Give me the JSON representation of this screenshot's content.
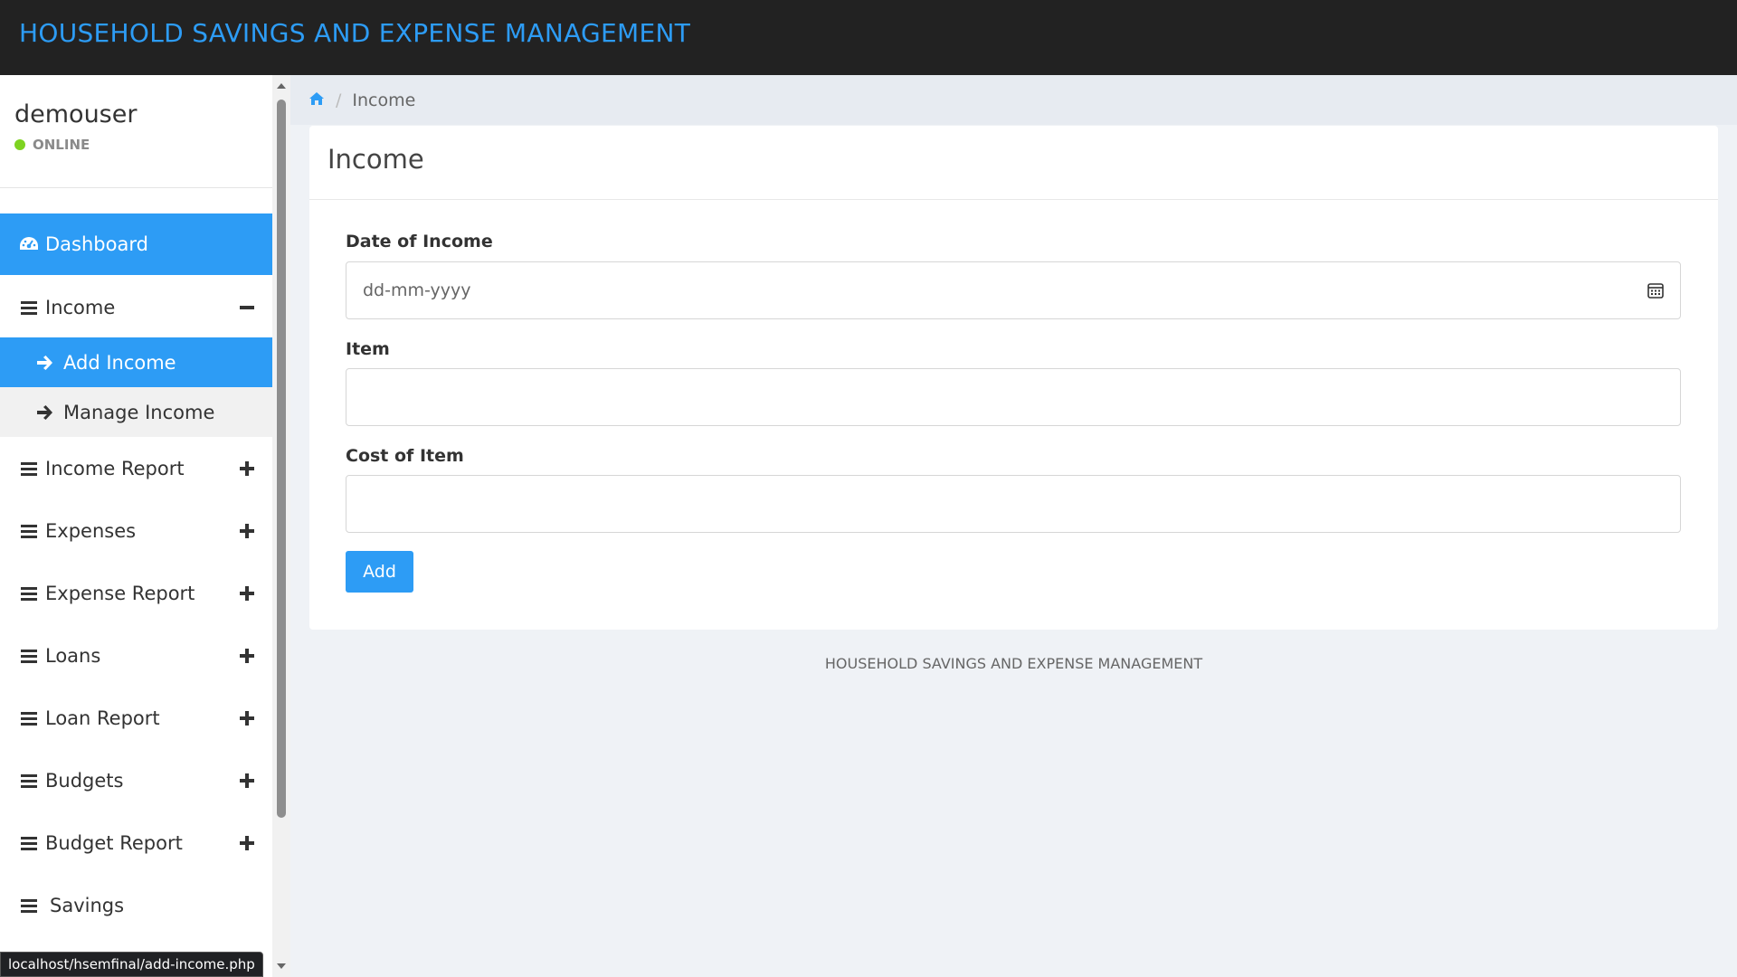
{
  "app": {
    "title": "HOUSEHOLD SAVINGS AND EXPENSE MANAGEMENT"
  },
  "user": {
    "name": "demouser",
    "status": "ONLINE"
  },
  "sidebar": {
    "dashboard": "Dashboard",
    "income": "Income",
    "add_income": "Add Income",
    "manage_income": "Manage Income",
    "income_report": "Income Report",
    "expenses": "Expenses",
    "expense_report": "Expense Report",
    "loans": "Loans",
    "loan_report": "Loan Report",
    "budgets": "Budgets",
    "budget_report": "Budget Report",
    "savings": "Savings"
  },
  "breadcrumb": {
    "current": "Income"
  },
  "card": {
    "title": "Income"
  },
  "form": {
    "date_label": "Date of Income",
    "date_placeholder": "dd-mm-yyyy",
    "item_label": "Item",
    "cost_label": "Cost of Item",
    "add_label": "Add"
  },
  "footer": {
    "text": "HOUSEHOLD SAVINGS AND EXPENSE MANAGEMENT"
  },
  "status_bar": {
    "url": "localhost/hsemfinal/add-income.php"
  },
  "colors": {
    "accent": "#2d9cf5",
    "topbar": "#222222",
    "online": "#7ed321"
  }
}
